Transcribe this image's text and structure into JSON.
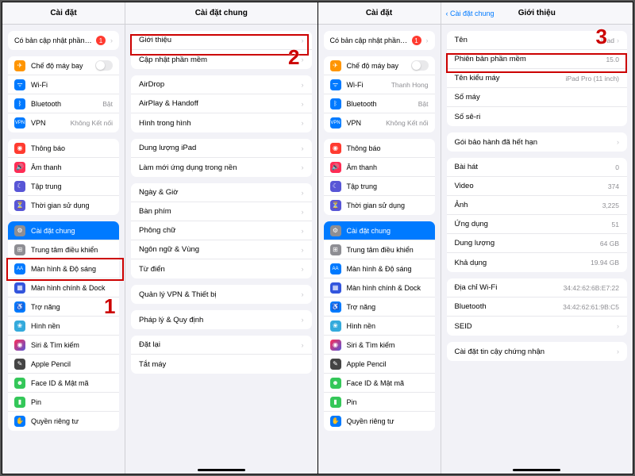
{
  "annotations": {
    "step1": "1",
    "step2": "2",
    "step3": "3"
  },
  "sidebar": {
    "title": "Cài đặt",
    "update_row": {
      "label": "Có bản cập nhật phần…",
      "badge": "1"
    },
    "g1": {
      "airplane": "Chế độ máy bay",
      "wifi": "Wi-Fi",
      "wifi_value_right": "Thanh Hong",
      "bluetooth": "Bluetooth",
      "bluetooth_value": "Bật",
      "vpn": "VPN",
      "vpn_value": "Không Kết nối"
    },
    "g2": {
      "notif": "Thông báo",
      "sound": "Âm thanh",
      "focus": "Tập trung",
      "screentime": "Thời gian sử dụng"
    },
    "g3": {
      "general": "Cài đặt chung",
      "control": "Trung tâm điều khiển",
      "display": "Màn hình & Độ sáng",
      "home": "Màn hình chính & Dock",
      "access": "Trợ năng",
      "wallpaper": "Hình nền",
      "siri": "Siri & Tìm kiếm",
      "pencil": "Apple Pencil",
      "faceid": "Face ID & Mật mã",
      "pin": "Pin",
      "privacy": "Quyền riêng tư"
    }
  },
  "panelA": {
    "title": "Cài đặt chung",
    "g1": {
      "about": "Giới thiệu",
      "swupdate": "Cập nhật phần mềm"
    },
    "g2": {
      "airdrop": "AirDrop",
      "airplay": "AirPlay & Handoff",
      "pip": "Hình trong hình"
    },
    "g3": {
      "storage": "Dung lượng iPad",
      "refresh": "Làm mới ứng dụng trong nền"
    },
    "g4": {
      "datetime": "Ngày & Giờ",
      "keyboard": "Bàn phím",
      "font": "Phông chữ",
      "lang": "Ngôn ngữ & Vùng",
      "dict": "Từ điển"
    },
    "g5": {
      "vpn": "Quản lý VPN & Thiết bị"
    },
    "g6": {
      "legal": "Pháp lý & Quy định"
    },
    "g7": {
      "reset": "Đặt lại",
      "shutdown": "Tắt máy"
    }
  },
  "panelB": {
    "back": "Cài đặt chung",
    "title": "Giới thiệu",
    "g1": {
      "name_l": "Tên",
      "name_v": "iPad",
      "sw_l": "Phiên bản phần mềm",
      "sw_v": "15.0",
      "model_l": "Tên kiểu máy",
      "model_v": "iPad Pro (11 inch)",
      "modelnum_l": "Số máy",
      "serial_l": "Số sê-ri"
    },
    "g2": {
      "warranty": "Gói bảo hành đã hết hạn"
    },
    "g3": {
      "songs_l": "Bài hát",
      "songs_v": "0",
      "videos_l": "Video",
      "videos_v": "374",
      "photos_l": "Ảnh",
      "photos_v": "3,225",
      "apps_l": "Ứng dụng",
      "apps_v": "51",
      "cap_l": "Dung lượng",
      "cap_v": "64 GB",
      "avail_l": "Khả dụng",
      "avail_v": "19.94 GB"
    },
    "g4": {
      "wifiaddr_l": "Địa chỉ Wi-Fi",
      "wifiaddr_v": "34:42:62:6B:E7:22",
      "bt_l": "Bluetooth",
      "bt_v": "34:42:62:61:9B:C5",
      "seid_l": "SEID"
    },
    "g5": {
      "cert": "Cài đặt tin cậy chứng nhận"
    }
  }
}
